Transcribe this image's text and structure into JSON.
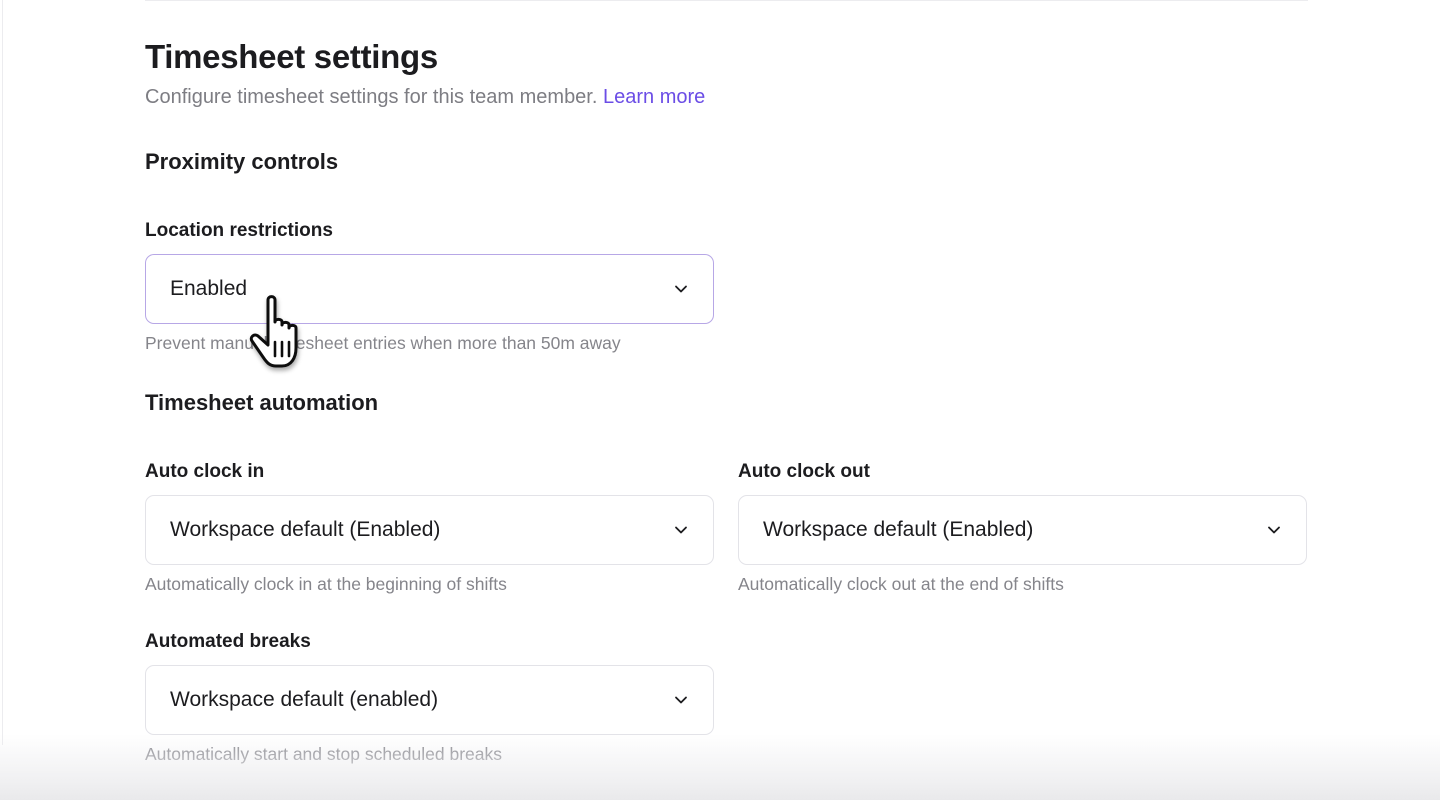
{
  "header": {
    "title": "Timesheet settings",
    "subtitle": "Configure timesheet settings for this team member.",
    "learn_more": "Learn more"
  },
  "proximity": {
    "heading": "Proximity controls",
    "location_restrictions": {
      "label": "Location restrictions",
      "value": "Enabled",
      "helper": "Prevent manual timesheet entries when more than 50m away"
    }
  },
  "automation": {
    "heading": "Timesheet automation",
    "auto_clock_in": {
      "label": "Auto clock in",
      "value": "Workspace default (Enabled)",
      "helper": "Automatically clock in at the beginning of shifts"
    },
    "auto_clock_out": {
      "label": "Auto clock out",
      "value": "Workspace default (Enabled)",
      "helper": "Automatically clock out at the end of shifts"
    },
    "automated_breaks": {
      "label": "Automated breaks",
      "value": "Workspace default (enabled)",
      "helper": "Automatically start and stop scheduled breaks"
    }
  },
  "icons": {
    "dropdown": "chevron-down-icon",
    "pointer": "hand-pointer-cursor"
  },
  "colors": {
    "accent": "#6b4de6",
    "focus_border": "#b7a7e6",
    "text_primary": "#1c1c1f",
    "text_muted": "#85858b"
  }
}
